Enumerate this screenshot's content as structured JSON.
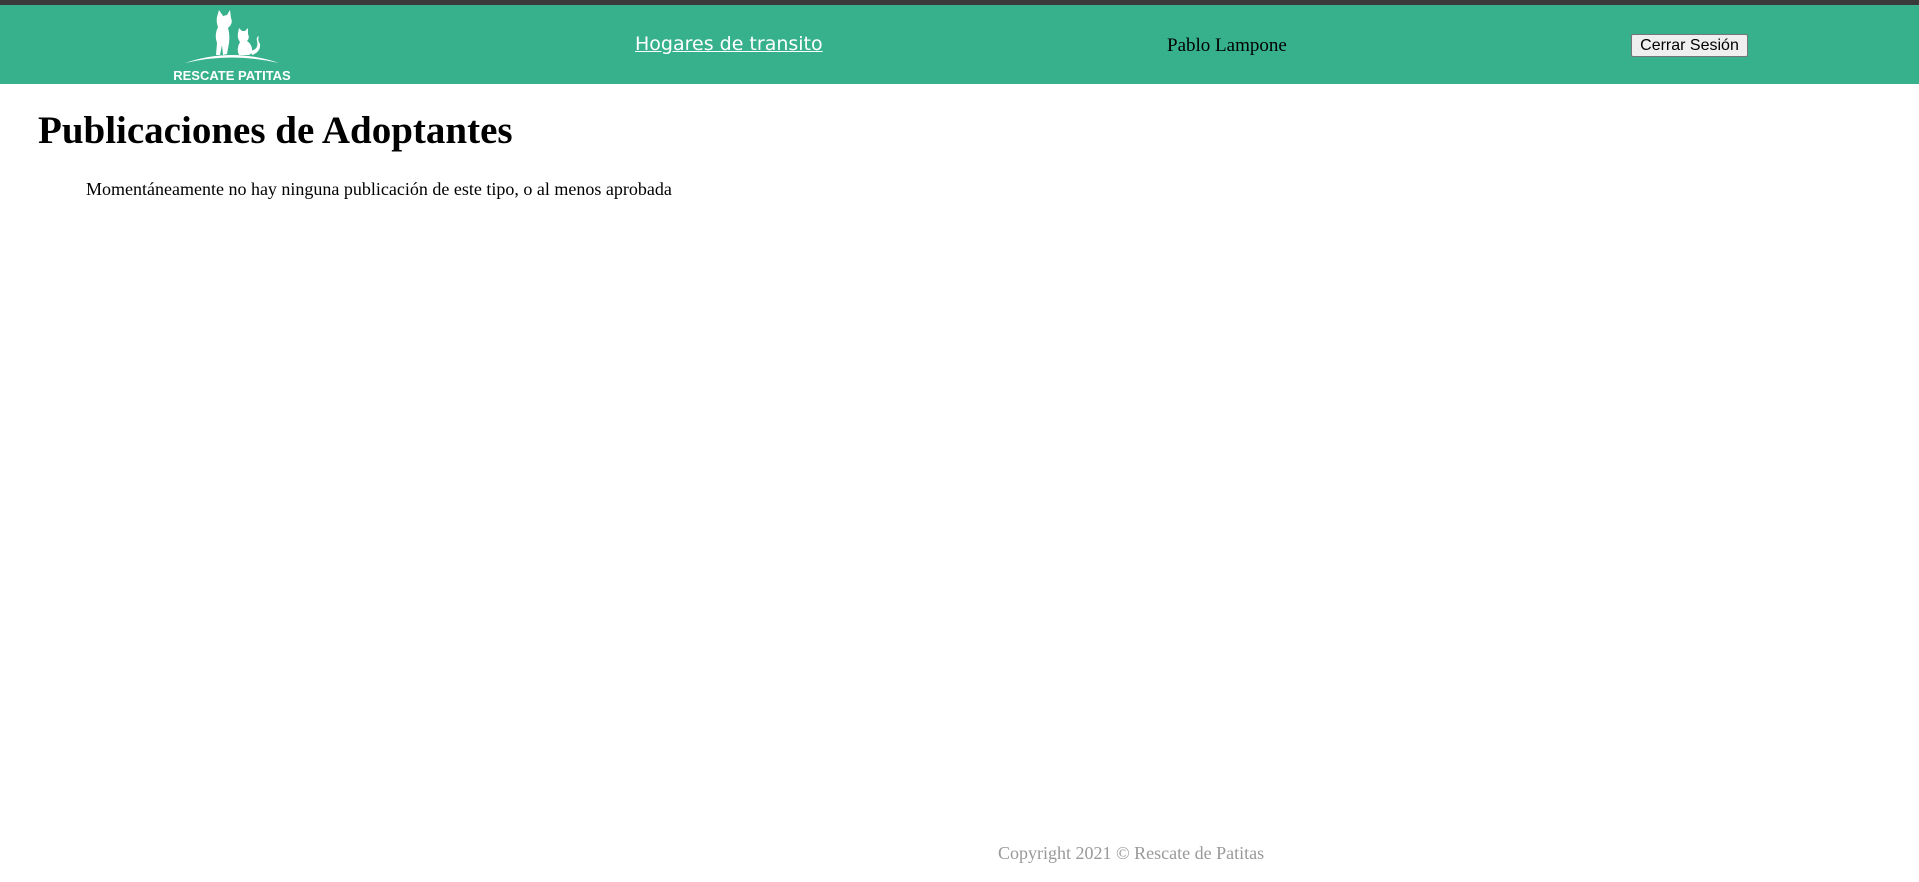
{
  "header": {
    "logo": {
      "text": "RESCATE PATITAS",
      "icon": "dog-and-cat-icon"
    },
    "nav_link": "Hogares de transito",
    "user_name": "Pablo Lampone",
    "logout_label": "Cerrar Sesión"
  },
  "main": {
    "title": "Publicaciones de Adoptantes",
    "empty_message": "Momentáneamente no hay ninguna publicación de este tipo, o al menos aprobada"
  },
  "footer": {
    "copyright": "Copyright 2021 © Rescate de Patitas"
  },
  "colors": {
    "navbar": "#37b18b",
    "top_strip": "#3a3a3a",
    "footer_text": "#999999"
  }
}
